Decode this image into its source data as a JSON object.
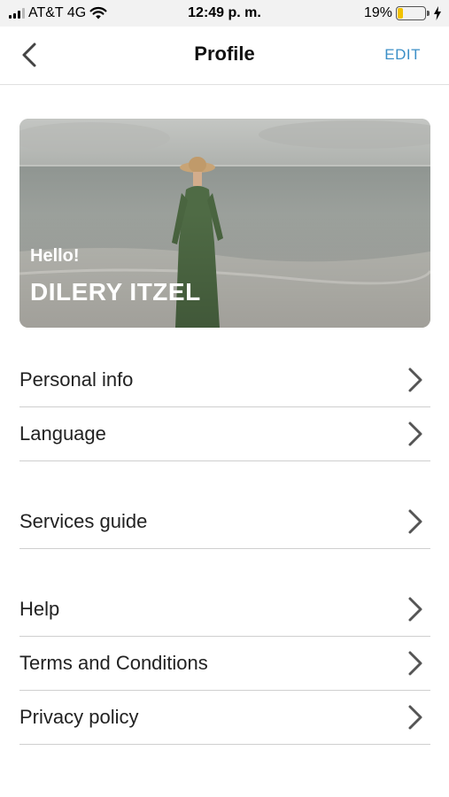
{
  "status_bar": {
    "carrier": "AT&T 4G",
    "time": "12:49 p. m.",
    "battery_percent": "19%",
    "battery_level": 0.19,
    "icons": [
      "signal-icon",
      "wifi-icon",
      "battery-icon",
      "charging-icon"
    ]
  },
  "header": {
    "title": "Profile",
    "edit_label": "EDIT",
    "back_icon": "chevron-left-icon"
  },
  "hero": {
    "greeting": "Hello!",
    "name": "DILERY ITZEL"
  },
  "menu": {
    "items": [
      {
        "label": "Personal info"
      },
      {
        "label": "Language"
      },
      {
        "label": "Services guide"
      },
      {
        "label": "Help"
      },
      {
        "label": "Terms and Conditions"
      },
      {
        "label": "Privacy policy"
      }
    ]
  },
  "colors": {
    "accent": "#3b8fc7",
    "status_bar_bg": "#f2f2f2",
    "battery": "#f2c200",
    "divider": "#cfcfcf"
  }
}
